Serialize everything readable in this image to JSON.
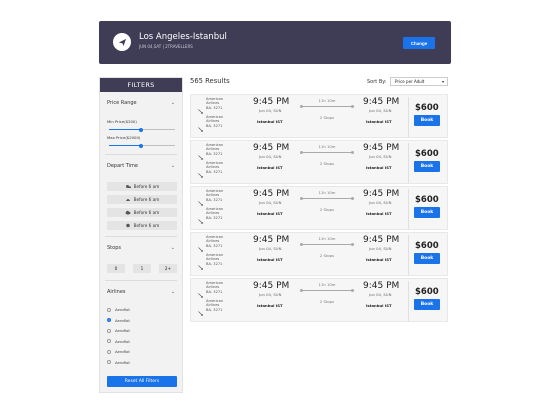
{
  "header": {
    "route": "Los Angeles-Istanbul",
    "subtitle": "JUN 04,SAT | 2TRAVELLERS",
    "change_label": "Change"
  },
  "sidebar": {
    "title": "FILTERS",
    "price_range": {
      "title": "Price Range",
      "min_label": "Min Price($200)",
      "max_label": "Max Price($2000)",
      "min_level": 0.48,
      "max_level": 0.48
    },
    "depart_time": {
      "title": "Depart Time",
      "options": [
        "Before 6 am",
        "Before 6 am",
        "Before 6 am",
        "Before 6 am"
      ]
    },
    "stops": {
      "title": "Stops",
      "options": [
        "0",
        "1",
        "2+"
      ]
    },
    "airlines": {
      "title": "Airlines",
      "items": [
        {
          "label": "Aeroflot",
          "checked": false
        },
        {
          "label": "Aeroflot",
          "checked": true
        },
        {
          "label": "Aeroflot",
          "checked": false
        },
        {
          "label": "Aeroflot",
          "checked": false
        },
        {
          "label": "Aeroflot",
          "checked": false
        },
        {
          "label": "Aeroflot",
          "checked": false
        }
      ]
    },
    "reset_label": "Reset All Filters"
  },
  "results": {
    "count_label": "565 Results",
    "sort_label": "Sort By:",
    "sort_value": "Price per Adult"
  },
  "flights": [
    {
      "price": "$600",
      "book": "Book",
      "outbound": {
        "airline": "American Airlines",
        "code": "BA- 3271",
        "dep_time": "9:45 PM",
        "dep_date": "Jun 04, SUN",
        "duration": "11h 10m",
        "stops": "2 Stops",
        "arr_time": "9:45 PM",
        "arr_date": "Jun 04, SUN"
      },
      "inbound": {
        "airline": "American Airlines",
        "code": "BA- 3271",
        "dep_city": "Istanbul IST",
        "arr_city": "Istanbul IST"
      }
    },
    {
      "price": "$600",
      "book": "Book",
      "outbound": {
        "airline": "American Airlines",
        "code": "BA- 3271",
        "dep_time": "9:45 PM",
        "dep_date": "Jun 04, SUN",
        "duration": "11h 10m",
        "stops": "2 Stops",
        "arr_time": "9:45 PM",
        "arr_date": "Jun 04, SUN"
      },
      "inbound": {
        "airline": "American Airlines",
        "code": "BA- 3271",
        "dep_city": "Istanbul IST",
        "arr_city": "Istanbul IST"
      }
    },
    {
      "price": "$600",
      "book": "Book",
      "outbound": {
        "airline": "American Airlines",
        "code": "BA- 3271",
        "dep_time": "9:45 PM",
        "dep_date": "Jun 04, SUN",
        "duration": "11h 10m",
        "stops": "2 Stops",
        "arr_time": "9:45 PM",
        "arr_date": "Jun 04, SUN"
      },
      "inbound": {
        "airline": "American Airlines",
        "code": "BA- 3271",
        "dep_city": "Istanbul IST",
        "arr_city": "Istanbul IST"
      }
    },
    {
      "price": "$600",
      "book": "Book",
      "outbound": {
        "airline": "American Airlines",
        "code": "BA- 3271",
        "dep_time": "9:45 PM",
        "dep_date": "Jun 04, SUN",
        "duration": "11h 10m",
        "stops": "2 Stops",
        "arr_time": "9:45 PM",
        "arr_date": "Jun 04, SUN"
      },
      "inbound": {
        "airline": "American Airlines",
        "code": "BA- 3271",
        "dep_city": "Istanbul IST",
        "arr_city": "Istanbul IST"
      }
    },
    {
      "price": "$600",
      "book": "Book",
      "outbound": {
        "airline": "American Airlines",
        "code": "BA- 3271",
        "dep_time": "9:45 PM",
        "dep_date": "Jun 04, SUN",
        "duration": "11h 10m",
        "stops": "2 Stops",
        "arr_time": "9:45 PM",
        "arr_date": "Jun 04, SUN"
      },
      "inbound": {
        "airline": "American Airlines",
        "code": "BA- 3271",
        "dep_city": "Istanbul IST",
        "arr_city": "Istanbul IST"
      }
    }
  ]
}
